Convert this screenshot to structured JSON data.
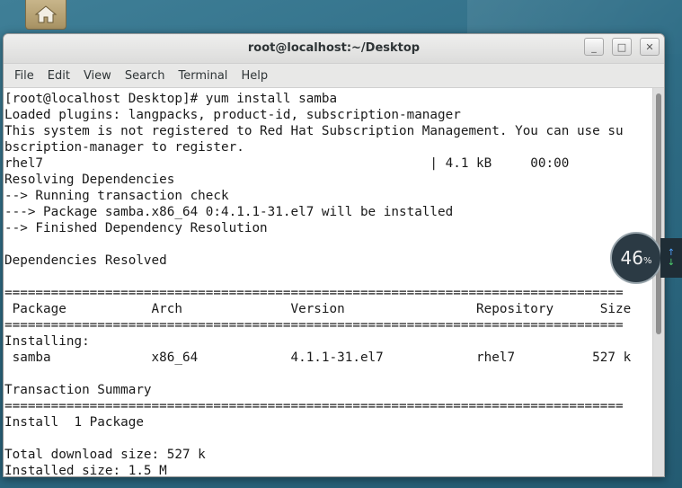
{
  "window": {
    "title": "root@localhost:~/Desktop"
  },
  "menubar": [
    "File",
    "Edit",
    "View",
    "Search",
    "Terminal",
    "Help"
  ],
  "terminal_lines": [
    "[root@localhost Desktop]# yum install samba",
    "Loaded plugins: langpacks, product-id, subscription-manager",
    "This system is not registered to Red Hat Subscription Management. You can use su",
    "bscription-manager to register.",
    "rhel7                                                  | 4.1 kB     00:00",
    "Resolving Dependencies",
    "--> Running transaction check",
    "---> Package samba.x86_64 0:4.1.1-31.el7 will be installed",
    "--> Finished Dependency Resolution",
    "",
    "Dependencies Resolved",
    "",
    "================================================================================",
    " Package           Arch              Version                 Repository      Size",
    "================================================================================",
    "Installing:",
    " samba             x86_64            4.1.1-31.el7            rhel7          527 k",
    "",
    "Transaction Summary",
    "================================================================================",
    "Install  1 Package",
    "",
    "Total download size: 527 k",
    "Installed size: 1.5 M"
  ],
  "net_widget": {
    "value": "46",
    "unit": "%"
  }
}
